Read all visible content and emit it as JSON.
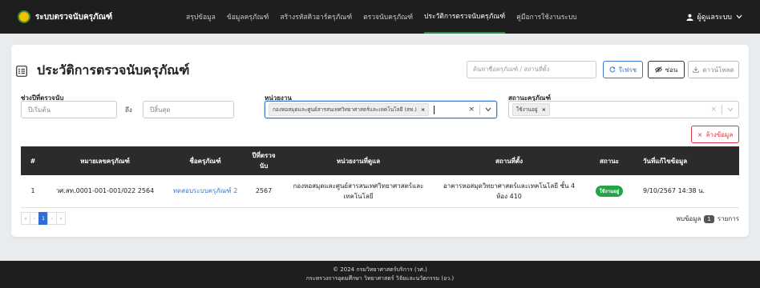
{
  "brand": {
    "name": "ระบบตรวจนับครุภัณฑ์"
  },
  "nav": {
    "items": [
      {
        "label": "สรุปข้อมูล",
        "active": false
      },
      {
        "label": "ข้อมูลครุภัณฑ์",
        "active": false
      },
      {
        "label": "สร้างรหัสคิวอาร์ครุภัณฑ์",
        "active": false
      },
      {
        "label": "ตรวจนับครุภัณฑ์",
        "active": false
      },
      {
        "label": "ประวัติการตรวจนับครุภัณฑ์",
        "active": true
      },
      {
        "label": "คู่มือการใช้งานระบบ",
        "active": false
      }
    ]
  },
  "user": {
    "name": "ผู้ดูแลระบบ"
  },
  "page": {
    "title": "ประวัติการตรวจนับครุภัณฑ์"
  },
  "toolbar": {
    "search_placeholder": "ค้นหาชื่อครุภัณฑ์ / สถานที่ตั้ง",
    "refresh_label": "รีเฟรช",
    "hide_label": "ซ่อน",
    "download_label": "ดาวน์โหลด"
  },
  "filters": {
    "year_label": "ช่วงปีที่ตรวจนับ",
    "year_start_placeholder": "ปีเริ่มต้น",
    "between_label": "ถึง",
    "year_end_placeholder": "ปีสิ้นสุด",
    "unit_label": "หน่วยงาน",
    "unit_selected": "กองหอสมุดและศูนย์สารสนเทศวิทยาศาสตร์และเทคโนโลยี (สท.)",
    "status_label": "สถานะครุภัณฑ์",
    "status_selected": "ใช้งานอยู่",
    "clear_label": "ล้างข้อมูล"
  },
  "table": {
    "headers": [
      "#",
      "หมายเลขครุภัณฑ์",
      "ชื่อครุภัณฑ์",
      "ปีที่ตรวจนับ",
      "หน่วยงานที่ดูแล",
      "สถานที่ตั้ง",
      "สถานะ",
      "วันที่แก้ไขข้อมูล"
    ],
    "rows": [
      {
        "index": "1",
        "asset_no": "วศ.สท.0001-001-001/022 2564",
        "asset_name": "ทดสอบระบบครุภัณฑ์ 2",
        "year": "2567",
        "unit": "กองหอสมุดและศูนย์สารสนเทศวิทยาศาสตร์และเทคโนโลยี",
        "location": "อาคารหอสมุดวิทยาศาสตร์และเทคโนโลยี ชั้น 4 ห้อง 410",
        "status": "ใช้งานอยู่",
        "updated": "9/10/2567 14:38 น."
      }
    ]
  },
  "pagination": {
    "first": "«",
    "prev": "‹",
    "current": "1",
    "next": "›",
    "last": "»"
  },
  "summary": {
    "prefix": "พบข้อมูล",
    "count": "1",
    "suffix": "รายการ"
  },
  "footer": {
    "line1": "© 2024 กรมวิทยาศาสตร์บริการ (วศ.)",
    "line2": "กระทรวงการอุดมศึกษา วิทยาศาสตร์ วิจัยและนวัตกรรม (อว.)"
  },
  "colors": {
    "accent": "#2e8b3e",
    "primary": "#3a78c9",
    "danger": "#dc3545",
    "success": "#22a447",
    "dark": "#1e1e1e"
  }
}
